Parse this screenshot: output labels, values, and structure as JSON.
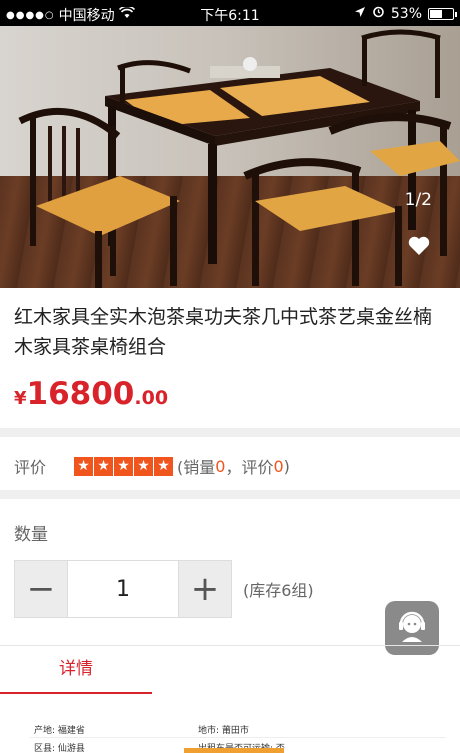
{
  "status_bar": {
    "carrier": "中国移动",
    "time": "下午6:11",
    "battery": "53%",
    "battery_level": 0.53
  },
  "gallery": {
    "page_indicator": "1/2"
  },
  "product": {
    "title": "红木家具全实木泡茶桌功夫茶几中式茶艺桌金丝楠木家具茶桌椅组合",
    "price_symbol": "¥",
    "price_integer": "16800",
    "price_decimal": ".00"
  },
  "rating": {
    "label": "评价",
    "stars": 5,
    "sales_prefix": "(销量",
    "sales_count": "0",
    "reviews_prefix": "，评价",
    "reviews_count": "0",
    "suffix": ")"
  },
  "quantity": {
    "label": "数量",
    "minus_label": "−",
    "value": "1",
    "plus_label": "+",
    "stock_text": "(库存6组)"
  },
  "tabs": {
    "detail_label": "详情"
  },
  "specs": {
    "origin": "产地: 福建省",
    "region": "区县: 仙游县",
    "city": "地市: 莆田市",
    "shipping": "出租车是否可运输: 否"
  },
  "colors": {
    "accent": "#d8232a",
    "star": "#f0551e"
  }
}
